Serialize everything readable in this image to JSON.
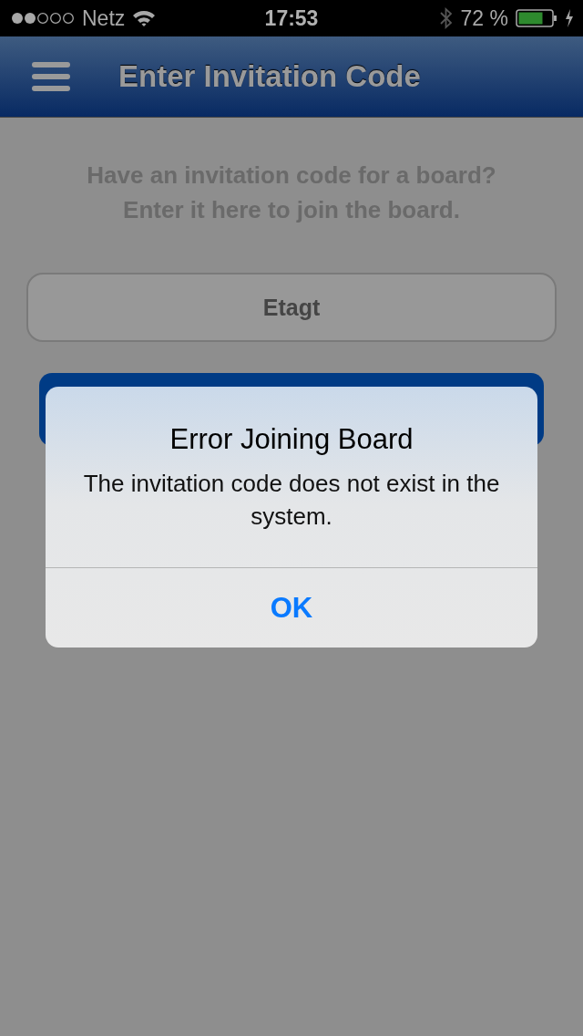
{
  "status_bar": {
    "carrier": "Netz",
    "time": "17:53",
    "battery_text": "72 %"
  },
  "nav_bar": {
    "title": "Enter Invitation Code"
  },
  "intro_lines": [
    "Have an invitation code for a board?",
    "Enter it here to join the board."
  ],
  "code_field": {
    "value": "Etagt"
  },
  "alert": {
    "title": "Error Joining Board",
    "message": "The invitation code does not exist in the system.",
    "buttons": [
      "OK"
    ]
  }
}
